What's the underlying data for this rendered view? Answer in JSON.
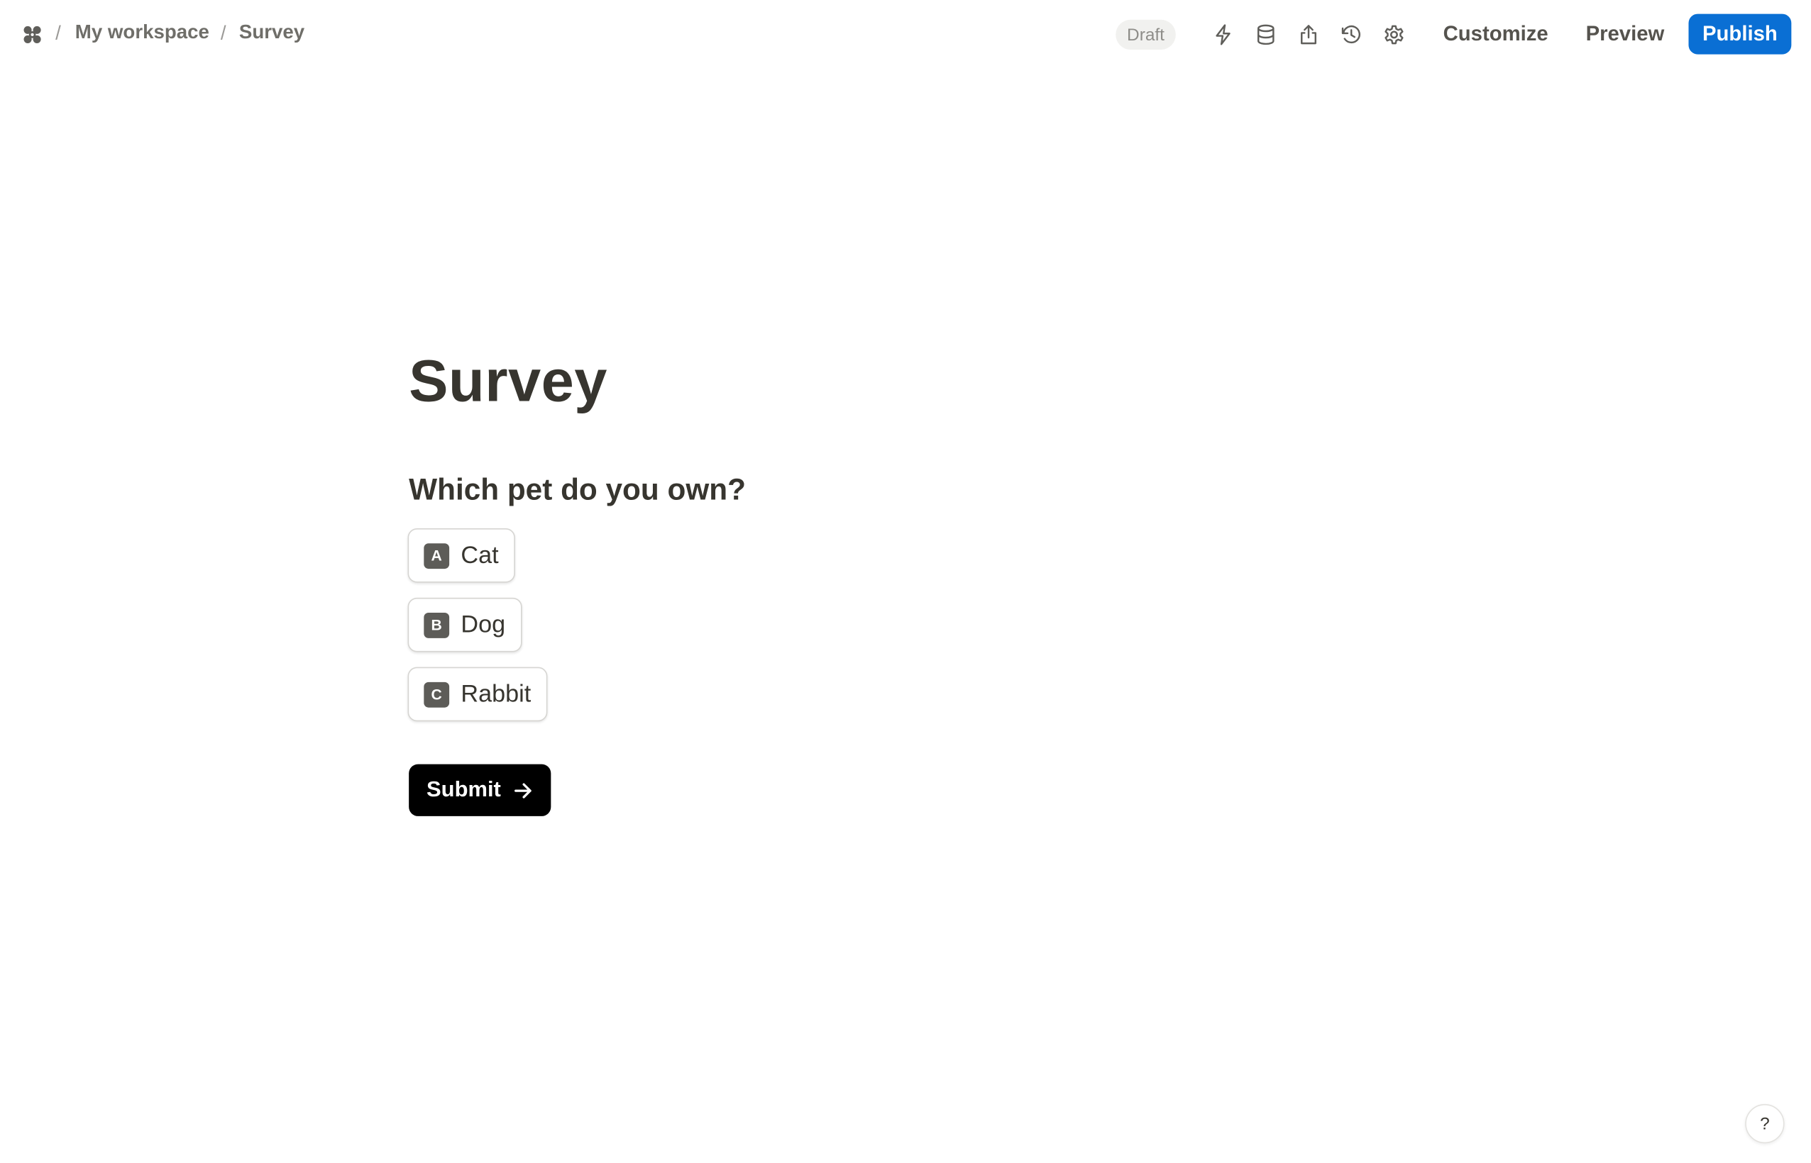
{
  "breadcrumb": {
    "logo_icon": "pinwheel-logo-icon",
    "separator": "/",
    "workspace": "My workspace",
    "page": "Survey"
  },
  "toolbar": {
    "status_badge": "Draft",
    "icons": [
      "lightning-icon",
      "database-icon",
      "share-icon",
      "history-icon",
      "gear-icon"
    ],
    "customize_label": "Customize",
    "preview_label": "Preview",
    "publish_label": "Publish",
    "publish_color": "#0a6fd4"
  },
  "form": {
    "title": "Survey",
    "question": "Which pet do you own?",
    "options": [
      {
        "key": "A",
        "label": "Cat"
      },
      {
        "key": "B",
        "label": "Dog"
      },
      {
        "key": "C",
        "label": "Rabbit"
      }
    ],
    "submit_label": "Submit",
    "submit_icon": "arrow-right-icon"
  },
  "help": {
    "label": "?"
  }
}
